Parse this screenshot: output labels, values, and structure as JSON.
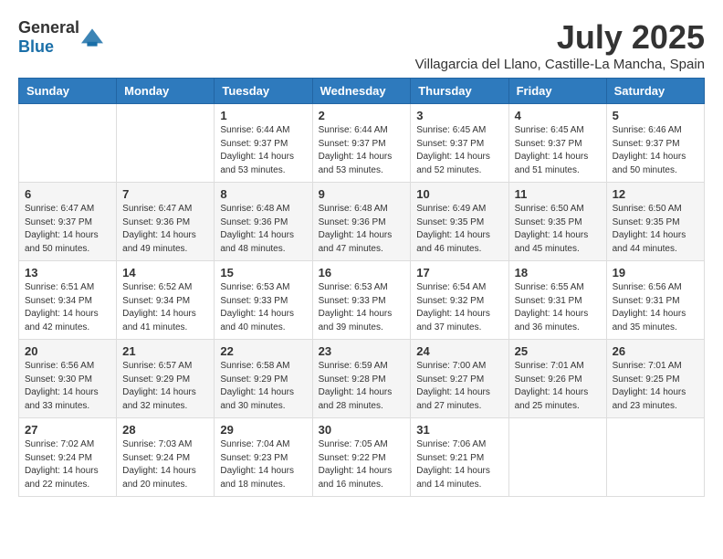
{
  "header": {
    "logo_general": "General",
    "logo_blue": "Blue",
    "month": "July 2025",
    "location": "Villagarcia del Llano, Castille-La Mancha, Spain"
  },
  "days_of_week": [
    "Sunday",
    "Monday",
    "Tuesday",
    "Wednesday",
    "Thursday",
    "Friday",
    "Saturday"
  ],
  "weeks": [
    [
      {
        "day": "",
        "info": ""
      },
      {
        "day": "",
        "info": ""
      },
      {
        "day": "1",
        "info": "Sunrise: 6:44 AM\nSunset: 9:37 PM\nDaylight: 14 hours and 53 minutes."
      },
      {
        "day": "2",
        "info": "Sunrise: 6:44 AM\nSunset: 9:37 PM\nDaylight: 14 hours and 53 minutes."
      },
      {
        "day": "3",
        "info": "Sunrise: 6:45 AM\nSunset: 9:37 PM\nDaylight: 14 hours and 52 minutes."
      },
      {
        "day": "4",
        "info": "Sunrise: 6:45 AM\nSunset: 9:37 PM\nDaylight: 14 hours and 51 minutes."
      },
      {
        "day": "5",
        "info": "Sunrise: 6:46 AM\nSunset: 9:37 PM\nDaylight: 14 hours and 50 minutes."
      }
    ],
    [
      {
        "day": "6",
        "info": "Sunrise: 6:47 AM\nSunset: 9:37 PM\nDaylight: 14 hours and 50 minutes."
      },
      {
        "day": "7",
        "info": "Sunrise: 6:47 AM\nSunset: 9:36 PM\nDaylight: 14 hours and 49 minutes."
      },
      {
        "day": "8",
        "info": "Sunrise: 6:48 AM\nSunset: 9:36 PM\nDaylight: 14 hours and 48 minutes."
      },
      {
        "day": "9",
        "info": "Sunrise: 6:48 AM\nSunset: 9:36 PM\nDaylight: 14 hours and 47 minutes."
      },
      {
        "day": "10",
        "info": "Sunrise: 6:49 AM\nSunset: 9:35 PM\nDaylight: 14 hours and 46 minutes."
      },
      {
        "day": "11",
        "info": "Sunrise: 6:50 AM\nSunset: 9:35 PM\nDaylight: 14 hours and 45 minutes."
      },
      {
        "day": "12",
        "info": "Sunrise: 6:50 AM\nSunset: 9:35 PM\nDaylight: 14 hours and 44 minutes."
      }
    ],
    [
      {
        "day": "13",
        "info": "Sunrise: 6:51 AM\nSunset: 9:34 PM\nDaylight: 14 hours and 42 minutes."
      },
      {
        "day": "14",
        "info": "Sunrise: 6:52 AM\nSunset: 9:34 PM\nDaylight: 14 hours and 41 minutes."
      },
      {
        "day": "15",
        "info": "Sunrise: 6:53 AM\nSunset: 9:33 PM\nDaylight: 14 hours and 40 minutes."
      },
      {
        "day": "16",
        "info": "Sunrise: 6:53 AM\nSunset: 9:33 PM\nDaylight: 14 hours and 39 minutes."
      },
      {
        "day": "17",
        "info": "Sunrise: 6:54 AM\nSunset: 9:32 PM\nDaylight: 14 hours and 37 minutes."
      },
      {
        "day": "18",
        "info": "Sunrise: 6:55 AM\nSunset: 9:31 PM\nDaylight: 14 hours and 36 minutes."
      },
      {
        "day": "19",
        "info": "Sunrise: 6:56 AM\nSunset: 9:31 PM\nDaylight: 14 hours and 35 minutes."
      }
    ],
    [
      {
        "day": "20",
        "info": "Sunrise: 6:56 AM\nSunset: 9:30 PM\nDaylight: 14 hours and 33 minutes."
      },
      {
        "day": "21",
        "info": "Sunrise: 6:57 AM\nSunset: 9:29 PM\nDaylight: 14 hours and 32 minutes."
      },
      {
        "day": "22",
        "info": "Sunrise: 6:58 AM\nSunset: 9:29 PM\nDaylight: 14 hours and 30 minutes."
      },
      {
        "day": "23",
        "info": "Sunrise: 6:59 AM\nSunset: 9:28 PM\nDaylight: 14 hours and 28 minutes."
      },
      {
        "day": "24",
        "info": "Sunrise: 7:00 AM\nSunset: 9:27 PM\nDaylight: 14 hours and 27 minutes."
      },
      {
        "day": "25",
        "info": "Sunrise: 7:01 AM\nSunset: 9:26 PM\nDaylight: 14 hours and 25 minutes."
      },
      {
        "day": "26",
        "info": "Sunrise: 7:01 AM\nSunset: 9:25 PM\nDaylight: 14 hours and 23 minutes."
      }
    ],
    [
      {
        "day": "27",
        "info": "Sunrise: 7:02 AM\nSunset: 9:24 PM\nDaylight: 14 hours and 22 minutes."
      },
      {
        "day": "28",
        "info": "Sunrise: 7:03 AM\nSunset: 9:24 PM\nDaylight: 14 hours and 20 minutes."
      },
      {
        "day": "29",
        "info": "Sunrise: 7:04 AM\nSunset: 9:23 PM\nDaylight: 14 hours and 18 minutes."
      },
      {
        "day": "30",
        "info": "Sunrise: 7:05 AM\nSunset: 9:22 PM\nDaylight: 14 hours and 16 minutes."
      },
      {
        "day": "31",
        "info": "Sunrise: 7:06 AM\nSunset: 9:21 PM\nDaylight: 14 hours and 14 minutes."
      },
      {
        "day": "",
        "info": ""
      },
      {
        "day": "",
        "info": ""
      }
    ]
  ]
}
